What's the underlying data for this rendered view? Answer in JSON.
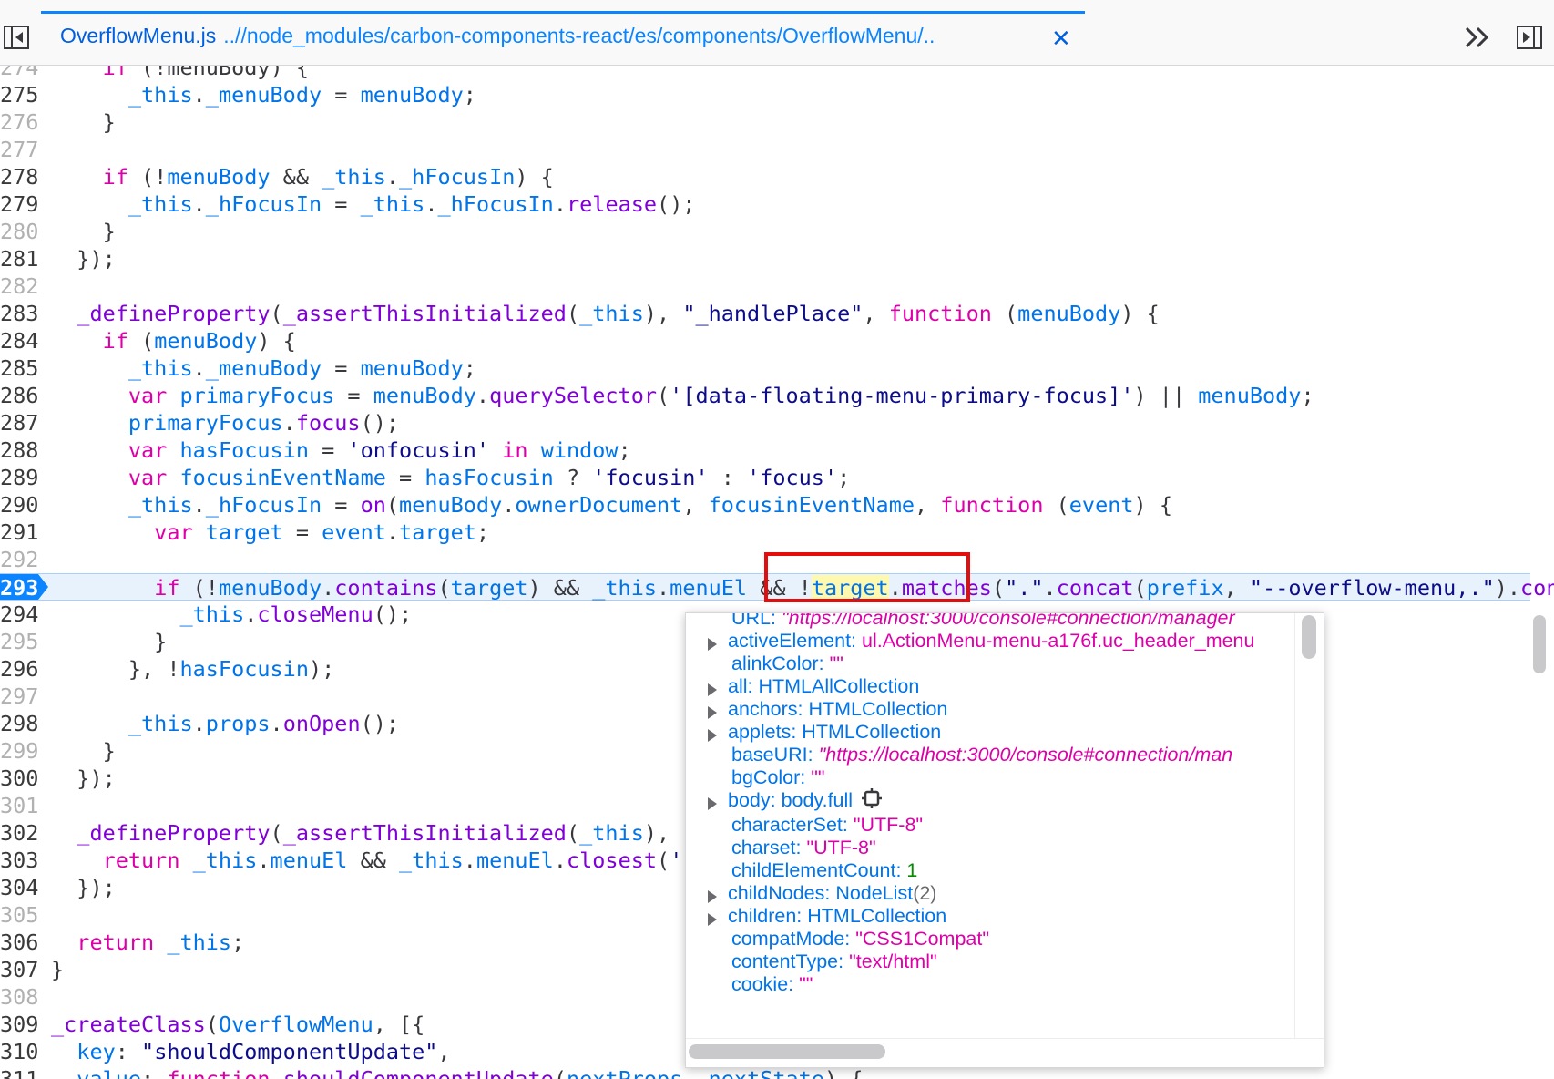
{
  "tab": {
    "file": "OverflowMenu.js",
    "path": "..//node_modules/carbon-components-react/es/components/OverflowMenu/..",
    "close": "✕"
  },
  "icons": {
    "left_toggle": "sidebar-left-icon",
    "chevrons": "double-chevron-right-icon",
    "right_toggle": "sidebar-right-icon",
    "close": "close-icon",
    "breakpoint": "breakpoint-marker",
    "inspect": "node-inspect-icon"
  },
  "colors": {
    "keyword": "#dd00a9",
    "identifier": "#0074e8",
    "function": "#8000d7",
    "string": "#0d0d8a",
    "breakpoint": "#0a84ff",
    "highlight_box": "#e30d0d"
  },
  "breakpoint_line": "293",
  "lines": [
    {
      "n": "274",
      "dim": true,
      "t": [
        [
          "pu",
          "    "
        ],
        [
          "kw",
          "if"
        ],
        [
          "pu",
          " (!menuBody) {"
        ]
      ]
    },
    {
      "n": "275",
      "t": [
        [
          "pu",
          "      "
        ],
        [
          "id",
          "_this"
        ],
        [
          "pu",
          "."
        ],
        [
          "id",
          "_menuBody"
        ],
        [
          "pu",
          " = "
        ],
        [
          "id",
          "menuBody"
        ],
        [
          "pu",
          ";"
        ]
      ]
    },
    {
      "n": "276",
      "dim": true,
      "t": [
        [
          "pu",
          "    }"
        ]
      ]
    },
    {
      "n": "277",
      "dim": true,
      "t": []
    },
    {
      "n": "278",
      "t": [
        [
          "pu",
          "    "
        ],
        [
          "kw",
          "if"
        ],
        [
          "pu",
          " (!"
        ],
        [
          "id",
          "menuBody"
        ],
        [
          "pu",
          " && "
        ],
        [
          "id",
          "_this"
        ],
        [
          "pu",
          "."
        ],
        [
          "id",
          "_hFocusIn"
        ],
        [
          "pu",
          ") {"
        ]
      ]
    },
    {
      "n": "279",
      "t": [
        [
          "pu",
          "      "
        ],
        [
          "id",
          "_this"
        ],
        [
          "pu",
          "."
        ],
        [
          "id",
          "_hFocusIn"
        ],
        [
          "pu",
          " = "
        ],
        [
          "id",
          "_this"
        ],
        [
          "pu",
          "."
        ],
        [
          "id",
          "_hFocusIn"
        ],
        [
          "pu",
          "."
        ],
        [
          "fn",
          "release"
        ],
        [
          "pu",
          "();"
        ]
      ]
    },
    {
      "n": "280",
      "dim": true,
      "t": [
        [
          "pu",
          "    }"
        ]
      ]
    },
    {
      "n": "281",
      "t": [
        [
          "pu",
          "  });"
        ]
      ]
    },
    {
      "n": "282",
      "dim": true,
      "t": []
    },
    {
      "n": "283",
      "t": [
        [
          "pu",
          "  "
        ],
        [
          "fn",
          "_defineProperty"
        ],
        [
          "pu",
          "("
        ],
        [
          "fn",
          "_assertThisInitialized"
        ],
        [
          "pu",
          "("
        ],
        [
          "id",
          "_this"
        ],
        [
          "pu",
          "), "
        ],
        [
          "str",
          "\"_handlePlace\""
        ],
        [
          "pu",
          ", "
        ],
        [
          "kw",
          "function"
        ],
        [
          "pu",
          " ("
        ],
        [
          "id",
          "menuBody"
        ],
        [
          "pu",
          ") {"
        ]
      ]
    },
    {
      "n": "284",
      "t": [
        [
          "pu",
          "    "
        ],
        [
          "kw",
          "if"
        ],
        [
          "pu",
          " ("
        ],
        [
          "id",
          "menuBody"
        ],
        [
          "pu",
          ") {"
        ]
      ]
    },
    {
      "n": "285",
      "t": [
        [
          "pu",
          "      "
        ],
        [
          "id",
          "_this"
        ],
        [
          "pu",
          "."
        ],
        [
          "id",
          "_menuBody"
        ],
        [
          "pu",
          " = "
        ],
        [
          "id",
          "menuBody"
        ],
        [
          "pu",
          ";"
        ]
      ]
    },
    {
      "n": "286",
      "t": [
        [
          "pu",
          "      "
        ],
        [
          "kw",
          "var"
        ],
        [
          "pu",
          " "
        ],
        [
          "id",
          "primaryFocus"
        ],
        [
          "pu",
          " = "
        ],
        [
          "id",
          "menuBody"
        ],
        [
          "pu",
          "."
        ],
        [
          "fn",
          "querySelector"
        ],
        [
          "pu",
          "("
        ],
        [
          "str",
          "'[data-floating-menu-primary-focus]'"
        ],
        [
          "pu",
          ") || "
        ],
        [
          "id",
          "menuBody"
        ],
        [
          "pu",
          ";"
        ]
      ]
    },
    {
      "n": "287",
      "t": [
        [
          "pu",
          "      "
        ],
        [
          "id",
          "primaryFocus"
        ],
        [
          "pu",
          "."
        ],
        [
          "fn",
          "focus"
        ],
        [
          "pu",
          "();"
        ]
      ]
    },
    {
      "n": "288",
      "t": [
        [
          "pu",
          "      "
        ],
        [
          "kw",
          "var"
        ],
        [
          "pu",
          " "
        ],
        [
          "id",
          "hasFocusin"
        ],
        [
          "pu",
          " = "
        ],
        [
          "str",
          "'onfocusin'"
        ],
        [
          "pu",
          " "
        ],
        [
          "kw",
          "in"
        ],
        [
          "pu",
          " "
        ],
        [
          "id",
          "window"
        ],
        [
          "pu",
          ";"
        ]
      ]
    },
    {
      "n": "289",
      "t": [
        [
          "pu",
          "      "
        ],
        [
          "kw",
          "var"
        ],
        [
          "pu",
          " "
        ],
        [
          "id",
          "focusinEventName"
        ],
        [
          "pu",
          " = "
        ],
        [
          "id",
          "hasFocusin"
        ],
        [
          "pu",
          " ? "
        ],
        [
          "str",
          "'focusin'"
        ],
        [
          "pu",
          " : "
        ],
        [
          "str",
          "'focus'"
        ],
        [
          "pu",
          ";"
        ]
      ]
    },
    {
      "n": "290",
      "t": [
        [
          "pu",
          "      "
        ],
        [
          "id",
          "_this"
        ],
        [
          "pu",
          "."
        ],
        [
          "id",
          "_hFocusIn"
        ],
        [
          "pu",
          " = "
        ],
        [
          "fn",
          "on"
        ],
        [
          "pu",
          "("
        ],
        [
          "id",
          "menuBody"
        ],
        [
          "pu",
          "."
        ],
        [
          "id",
          "ownerDocument"
        ],
        [
          "pu",
          ", "
        ],
        [
          "id",
          "focusinEventName"
        ],
        [
          "pu",
          ", "
        ],
        [
          "kw",
          "function"
        ],
        [
          "pu",
          " ("
        ],
        [
          "id",
          "event"
        ],
        [
          "pu",
          ") {"
        ]
      ]
    },
    {
      "n": "291",
      "t": [
        [
          "pu",
          "        "
        ],
        [
          "kw",
          "var"
        ],
        [
          "pu",
          " "
        ],
        [
          "id",
          "target"
        ],
        [
          "pu",
          " = "
        ],
        [
          "id",
          "event"
        ],
        [
          "pu",
          "."
        ],
        [
          "id",
          "target"
        ],
        [
          "pu",
          ";"
        ]
      ]
    },
    {
      "n": "292",
      "dim": true,
      "t": []
    },
    {
      "n": "293",
      "exec": true,
      "t": [
        [
          "pu",
          "        "
        ],
        [
          "kw",
          "if"
        ],
        [
          "pu",
          " (!"
        ],
        [
          "id",
          "menuBody"
        ],
        [
          "pu",
          "."
        ],
        [
          "fn",
          "contains"
        ],
        [
          "pu",
          "("
        ],
        [
          "id",
          "target"
        ],
        [
          "pu",
          ") && "
        ],
        [
          "id",
          "_this"
        ],
        [
          "pu",
          "."
        ],
        [
          "id",
          "menuEl"
        ],
        [
          "pu",
          " && !"
        ],
        [
          "hl",
          "target"
        ],
        [
          "pu",
          "."
        ],
        [
          "fn",
          "matches"
        ],
        [
          "pu",
          "("
        ],
        [
          "str",
          "\".\""
        ],
        [
          "pu",
          "."
        ],
        [
          "fn",
          "concat"
        ],
        [
          "pu",
          "("
        ],
        [
          "id",
          "prefix"
        ],
        [
          "pu",
          ", "
        ],
        [
          "str",
          "\"--overflow-menu,.\""
        ],
        [
          "pu",
          ")."
        ],
        [
          "fn",
          "concat"
        ],
        [
          "pu",
          "("
        ]
      ]
    },
    {
      "n": "294",
      "t": [
        [
          "pu",
          "          "
        ],
        [
          "id",
          "_this"
        ],
        [
          "pu",
          "."
        ],
        [
          "fn",
          "closeMenu"
        ],
        [
          "pu",
          "();"
        ]
      ]
    },
    {
      "n": "295",
      "dim": true,
      "t": [
        [
          "pu",
          "        }"
        ]
      ]
    },
    {
      "n": "296",
      "t": [
        [
          "pu",
          "      }, !"
        ],
        [
          "id",
          "hasFocusin"
        ],
        [
          "pu",
          ");"
        ]
      ]
    },
    {
      "n": "297",
      "dim": true,
      "t": []
    },
    {
      "n": "298",
      "t": [
        [
          "pu",
          "      "
        ],
        [
          "id",
          "_this"
        ],
        [
          "pu",
          "."
        ],
        [
          "id",
          "props"
        ],
        [
          "pu",
          "."
        ],
        [
          "fn",
          "onOpen"
        ],
        [
          "pu",
          "();"
        ]
      ]
    },
    {
      "n": "299",
      "dim": true,
      "t": [
        [
          "pu",
          "    }"
        ]
      ]
    },
    {
      "n": "300",
      "t": [
        [
          "pu",
          "  });"
        ]
      ]
    },
    {
      "n": "301",
      "dim": true,
      "t": []
    },
    {
      "n": "302",
      "t": [
        [
          "pu",
          "  "
        ],
        [
          "fn",
          "_defineProperty"
        ],
        [
          "pu",
          "("
        ],
        [
          "fn",
          "_assertThisInitialized"
        ],
        [
          "pu",
          "("
        ],
        [
          "id",
          "_this"
        ],
        [
          "pu",
          "), "
        ],
        [
          "str",
          "\"_"
        ]
      ]
    },
    {
      "n": "303",
      "t": [
        [
          "pu",
          "    "
        ],
        [
          "kw",
          "return"
        ],
        [
          "pu",
          " "
        ],
        [
          "id",
          "_this"
        ],
        [
          "pu",
          "."
        ],
        [
          "id",
          "menuEl"
        ],
        [
          "pu",
          " && "
        ],
        [
          "id",
          "_this"
        ],
        [
          "pu",
          "."
        ],
        [
          "id",
          "menuEl"
        ],
        [
          "pu",
          "."
        ],
        [
          "fn",
          "closest"
        ],
        [
          "pu",
          "("
        ],
        [
          "str",
          "'[d"
        ]
      ]
    },
    {
      "n": "304",
      "t": [
        [
          "pu",
          "  });"
        ]
      ]
    },
    {
      "n": "305",
      "dim": true,
      "t": []
    },
    {
      "n": "306",
      "t": [
        [
          "pu",
          "  "
        ],
        [
          "kw",
          "return"
        ],
        [
          "pu",
          " "
        ],
        [
          "id",
          "_this"
        ],
        [
          "pu",
          ";"
        ]
      ]
    },
    {
      "n": "307",
      "t": [
        [
          "pu",
          "}"
        ]
      ]
    },
    {
      "n": "308",
      "dim": true,
      "t": []
    },
    {
      "n": "309",
      "t": [
        [
          "fn",
          "_createClass"
        ],
        [
          "pu",
          "("
        ],
        [
          "id",
          "OverflowMenu"
        ],
        [
          "pu",
          ", [{"
        ]
      ]
    },
    {
      "n": "310",
      "t": [
        [
          "pu",
          "  "
        ],
        [
          "id",
          "key"
        ],
        [
          "pu",
          ": "
        ],
        [
          "str",
          "\"shouldComponentUpdate\""
        ],
        [
          "pu",
          ","
        ]
      ]
    },
    {
      "n": "311",
      "t": [
        [
          "pu",
          "  "
        ],
        [
          "id",
          "value"
        ],
        [
          "pu",
          ": "
        ],
        [
          "kw",
          "function"
        ],
        [
          "pu",
          " "
        ],
        [
          "fn",
          "shouldComponentUpdate"
        ],
        [
          "pu",
          "("
        ],
        [
          "id",
          "nextProps"
        ],
        [
          "pu",
          ", "
        ],
        [
          "id",
          "nextState"
        ],
        [
          "pu",
          ") {"
        ]
      ]
    }
  ],
  "popup": [
    {
      "k": "URL",
      "v": "\"https://localhost:3000/console#connection/manager",
      "vt": "url",
      "tw": false
    },
    {
      "k": "activeElement",
      "v": "ul.ActionMenu-menu-a176f.uc_header_menu",
      "vt": "str",
      "tw": true
    },
    {
      "k": "alinkColor",
      "v": "\"\"",
      "vt": "str",
      "tw": false
    },
    {
      "k": "all",
      "v": "HTMLAllCollection",
      "vt": "obj",
      "tw": true
    },
    {
      "k": "anchors",
      "v": "HTMLCollection",
      "vt": "obj",
      "tw": true
    },
    {
      "k": "applets",
      "v": "HTMLCollection",
      "vt": "obj",
      "tw": true
    },
    {
      "k": "baseURI",
      "v": "\"https://localhost:3000/console#connection/man",
      "vt": "url",
      "tw": false
    },
    {
      "k": "bgColor",
      "v": "\"\"",
      "vt": "str",
      "tw": false
    },
    {
      "k": "body",
      "v": "body.full",
      "vt": "obj",
      "tw": true,
      "inspect": true
    },
    {
      "k": "characterSet",
      "v": "\"UTF-8\"",
      "vt": "str",
      "tw": false
    },
    {
      "k": "charset",
      "v": "\"UTF-8\"",
      "vt": "str",
      "tw": false
    },
    {
      "k": "childElementCount",
      "v": "1",
      "vt": "num",
      "tw": false
    },
    {
      "k": "childNodes",
      "v": "NodeList",
      "vt": "obj",
      "tw": true,
      "cnt": "(2)"
    },
    {
      "k": "children",
      "v": "HTMLCollection",
      "vt": "obj",
      "tw": true
    },
    {
      "k": "compatMode",
      "v": "\"CSS1Compat\"",
      "vt": "str",
      "tw": false
    },
    {
      "k": "contentType",
      "v": "\"text/html\"",
      "vt": "str",
      "tw": false
    },
    {
      "k": "cookie",
      "v": "\"\"",
      "vt": "str",
      "tw": false
    }
  ]
}
